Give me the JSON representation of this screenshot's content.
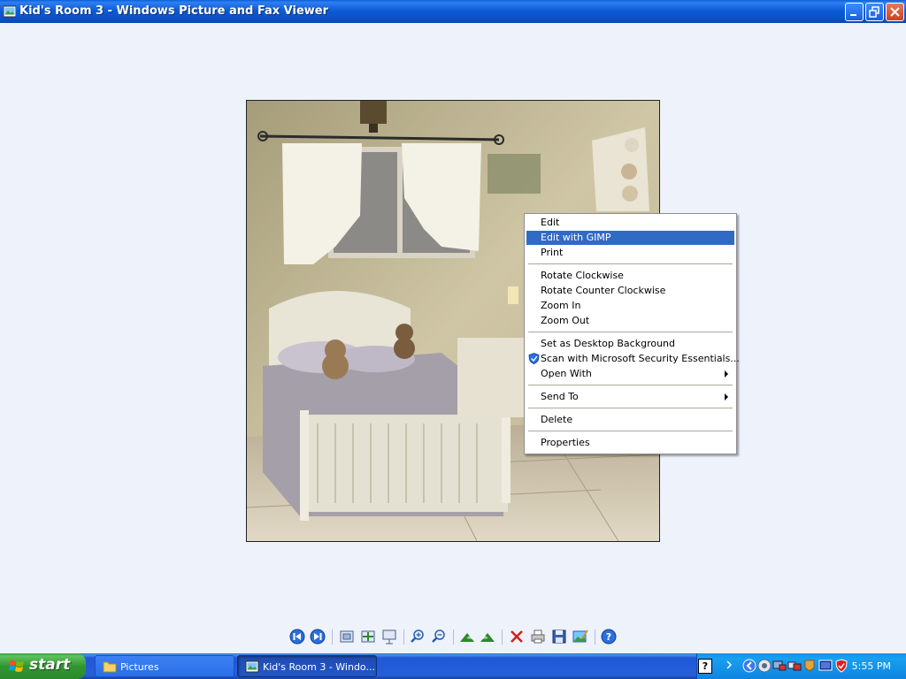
{
  "window": {
    "title": "Kid's Room 3 - Windows Picture and Fax Viewer"
  },
  "image": {
    "description_icon": "bedroom-photo"
  },
  "context_menu": {
    "items": [
      {
        "label": "Edit"
      },
      {
        "label": "Edit with GIMP",
        "highlighted": true
      },
      {
        "label": "Print"
      },
      {
        "label": "Rotate Clockwise"
      },
      {
        "label": "Rotate Counter Clockwise"
      },
      {
        "label": "Zoom In"
      },
      {
        "label": "Zoom Out"
      },
      {
        "label": "Set as Desktop Background"
      },
      {
        "label": "Scan with Microsoft Security Essentials..."
      },
      {
        "label": "Open With",
        "submenu": true
      },
      {
        "label": "Send To",
        "submenu": true
      },
      {
        "label": "Delete"
      },
      {
        "label": "Properties"
      }
    ]
  },
  "toolbar": {
    "buttons": [
      "previous-image-icon",
      "next-image-icon",
      "best-fit-icon",
      "actual-size-icon",
      "slideshow-icon",
      "zoom-in-icon",
      "zoom-out-icon",
      "rotate-clockwise-icon",
      "rotate-counterclockwise-icon",
      "delete-icon",
      "print-icon",
      "save-icon",
      "edit-icon",
      "help-icon"
    ]
  },
  "taskbar": {
    "start_label": "start",
    "tasks": [
      {
        "label": "Pictures"
      },
      {
        "label": "Kid's Room 3 - Windo..."
      }
    ],
    "tray": {
      "help_glyph": "?",
      "clock": "5:55 PM"
    }
  },
  "colors": {
    "menu_highlight": "#316ac5",
    "titlebar": "#0852c8",
    "taskbar": "#2560d8",
    "start_button": "#329632",
    "background": "#eef2fb"
  }
}
